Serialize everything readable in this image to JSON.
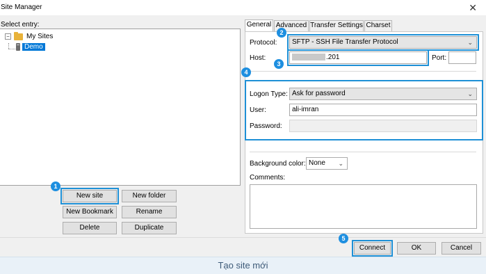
{
  "window": {
    "title": "Site Manager",
    "close_symbol": "✕"
  },
  "tree": {
    "select_label": "Select entry:",
    "root": {
      "expander": "−",
      "label": "My Sites"
    },
    "site": {
      "label": "Demo"
    }
  },
  "left_buttons": {
    "new_site": "New site",
    "new_folder": "New folder",
    "new_bookmark": "New Bookmark",
    "rename": "Rename",
    "delete": "Delete",
    "duplicate": "Duplicate"
  },
  "tabs": [
    "General",
    "Advanced",
    "Transfer Settings",
    "Charset"
  ],
  "general": {
    "protocol_label": "Protocol:",
    "protocol_value": "SFTP - SSH File Transfer Protocol",
    "host_label": "Host:",
    "host_value_visible": ".201",
    "port_label": "Port:",
    "port_value": "",
    "logon_type_label": "Logon Type:",
    "logon_type_value": "Ask for password",
    "user_label": "User:",
    "user_value": "ali-imran",
    "password_label": "Password:",
    "password_value": "",
    "bg_color_label": "Background color:",
    "bg_color_value": "None",
    "comments_label": "Comments:",
    "comments_value": ""
  },
  "footer_buttons": {
    "connect": "Connect",
    "ok": "OK",
    "cancel": "Cancel"
  },
  "badges": [
    "1",
    "2",
    "3",
    "4",
    "5"
  ],
  "caption": "Tạo site mới",
  "icons": {
    "expander": "minus-box-icon",
    "folder": "folder-icon",
    "site": "server-icon",
    "dropdown": "chevron-down-icon",
    "close": "close-icon"
  },
  "colors": {
    "highlight": "#1e90d6",
    "selection": "#0078d7",
    "folder": "#e8b23a",
    "caption_bg": "#e9f1f8"
  }
}
